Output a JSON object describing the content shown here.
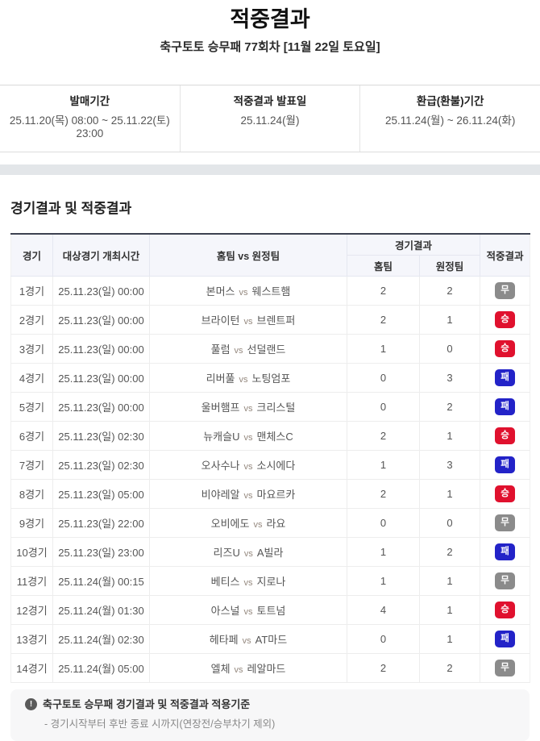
{
  "header": {
    "title": "적중결과",
    "subtitle": "축구토토 승무패 77회차 [11월 22일 토요일]"
  },
  "info": {
    "columns": [
      {
        "label": "발매기간",
        "value": "25.11.20(목) 08:00 ~ 25.11.22(토) 23:00"
      },
      {
        "label": "적중결과 발표일",
        "value": "25.11.24(월)"
      },
      {
        "label": "환급(환불)기간",
        "value": "25.11.24(월) ~ 26.11.24(화)"
      }
    ]
  },
  "section": {
    "title": "경기결과 및 적중결과"
  },
  "table": {
    "headers": {
      "match": "경기",
      "time": "대상경기 개최시간",
      "teams": "홈팀 vs 원정팀",
      "result_group": "경기결과",
      "home": "홈팀",
      "away": "원정팀",
      "hit": "적중결과"
    },
    "vs_label": "vs",
    "rows": [
      {
        "match": "1경기",
        "time": "25.11.23(일) 00:00",
        "home_team": "본머스",
        "away_team": "웨스트햄",
        "home_score": "2",
        "away_score": "2",
        "result": "무"
      },
      {
        "match": "2경기",
        "time": "25.11.23(일) 00:00",
        "home_team": "브라이턴",
        "away_team": "브렌트퍼",
        "home_score": "2",
        "away_score": "1",
        "result": "승"
      },
      {
        "match": "3경기",
        "time": "25.11.23(일) 00:00",
        "home_team": "풀럼",
        "away_team": "선덜랜드",
        "home_score": "1",
        "away_score": "0",
        "result": "승"
      },
      {
        "match": "4경기",
        "time": "25.11.23(일) 00:00",
        "home_team": "리버풀",
        "away_team": "노팅엄포",
        "home_score": "0",
        "away_score": "3",
        "result": "패"
      },
      {
        "match": "5경기",
        "time": "25.11.23(일) 00:00",
        "home_team": "울버햄프",
        "away_team": "크리스털",
        "home_score": "0",
        "away_score": "2",
        "result": "패"
      },
      {
        "match": "6경기",
        "time": "25.11.23(일) 02:30",
        "home_team": "뉴캐슬U",
        "away_team": "맨체스C",
        "home_score": "2",
        "away_score": "1",
        "result": "승"
      },
      {
        "match": "7경기",
        "time": "25.11.23(일) 02:30",
        "home_team": "오사수나",
        "away_team": "소시에다",
        "home_score": "1",
        "away_score": "3",
        "result": "패"
      },
      {
        "match": "8경기",
        "time": "25.11.23(일) 05:00",
        "home_team": "비야레알",
        "away_team": "마요르카",
        "home_score": "2",
        "away_score": "1",
        "result": "승"
      },
      {
        "match": "9경기",
        "time": "25.11.23(일) 22:00",
        "home_team": "오비에도",
        "away_team": "라요",
        "home_score": "0",
        "away_score": "0",
        "result": "무"
      },
      {
        "match": "10경기",
        "time": "25.11.23(일) 23:00",
        "home_team": "리즈U",
        "away_team": "A빌라",
        "home_score": "1",
        "away_score": "2",
        "result": "패"
      },
      {
        "match": "11경기",
        "time": "25.11.24(월) 00:15",
        "home_team": "베티스",
        "away_team": "지로나",
        "home_score": "1",
        "away_score": "1",
        "result": "무"
      },
      {
        "match": "12경기",
        "time": "25.11.24(월) 01:30",
        "home_team": "아스널",
        "away_team": "토트넘",
        "home_score": "4",
        "away_score": "1",
        "result": "승"
      },
      {
        "match": "13경기",
        "time": "25.11.24(월) 02:30",
        "home_team": "헤타페",
        "away_team": "AT마드",
        "home_score": "0",
        "away_score": "1",
        "result": "패"
      },
      {
        "match": "14경기",
        "time": "25.11.24(월) 05:00",
        "home_team": "엘체",
        "away_team": "레알마드",
        "home_score": "2",
        "away_score": "2",
        "result": "무"
      }
    ]
  },
  "badge_colors": {
    "승": "#e0112e",
    "무": "#8b8b8b",
    "패": "#2323c8"
  },
  "note": {
    "icon": "!",
    "title": "축구토토 승무패 경기결과 및 적중결과 적용기준",
    "line": "- 경기시작부터 후반 종료 시까지(연장전/승부차기 제외)"
  }
}
